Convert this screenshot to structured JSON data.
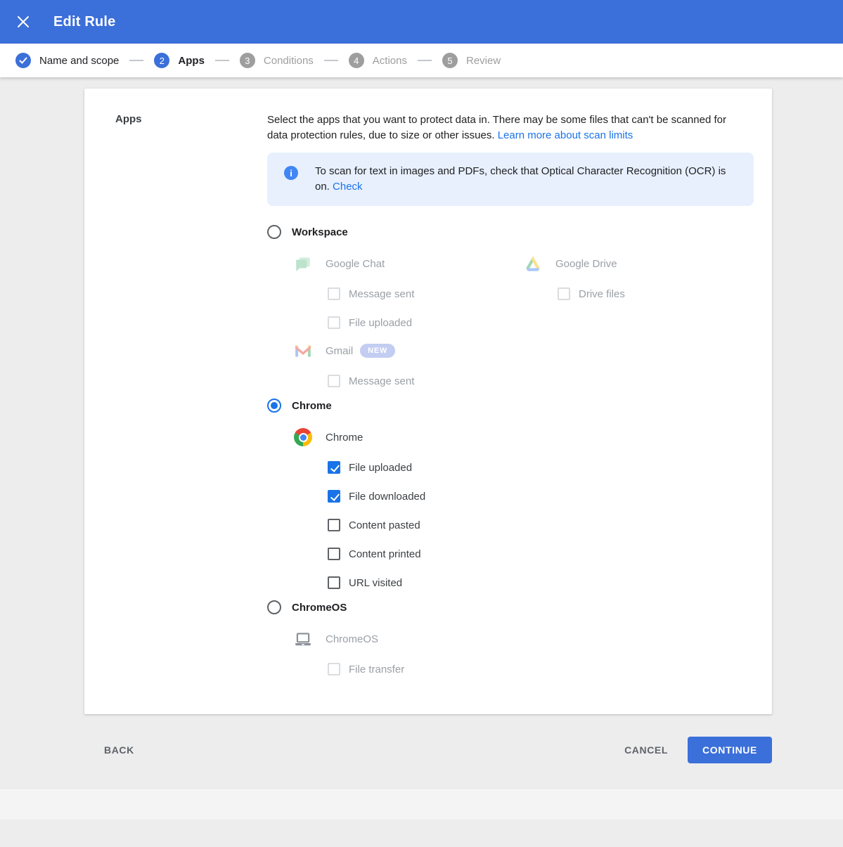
{
  "header": {
    "title": "Edit Rule"
  },
  "stepper": {
    "steps": [
      {
        "label": "Name and scope",
        "state": "complete"
      },
      {
        "number": "2",
        "label": "Apps",
        "state": "active"
      },
      {
        "number": "3",
        "label": "Conditions",
        "state": "upcoming"
      },
      {
        "number": "4",
        "label": "Actions",
        "state": "upcoming"
      },
      {
        "number": "5",
        "label": "Review",
        "state": "upcoming"
      }
    ]
  },
  "card": {
    "section_label": "Apps",
    "intro_text": "Select the apps that you want to protect data in. There may be some files that can't be scanned for data protection rules, due to size or other issues. ",
    "intro_link": "Learn more about scan limits",
    "ocr_banner": {
      "icon": "info-icon",
      "icon_glyph": "i",
      "text": "To scan for text in images and PDFs, check that Optical Character Recognition (OCR) is on. ",
      "link_label": "Check"
    },
    "workspace": {
      "label": "Workspace",
      "selected": false,
      "chat": {
        "name": "Google Chat",
        "icon": "google-chat-icon",
        "events": [
          {
            "label": "Message sent",
            "checked": false
          },
          {
            "label": "File uploaded",
            "checked": false
          }
        ]
      },
      "drive": {
        "name": "Google Drive",
        "icon": "google-drive-icon",
        "events": [
          {
            "label": "Drive files",
            "checked": false
          }
        ]
      },
      "gmail": {
        "name": "Gmail",
        "icon": "gmail-icon",
        "badge": "NEW",
        "events": [
          {
            "label": "Message sent",
            "checked": false
          }
        ]
      }
    },
    "chrome": {
      "label": "Chrome",
      "selected": true,
      "app": {
        "name": "Chrome",
        "icon": "chrome-icon",
        "events": [
          {
            "label": "File uploaded",
            "checked": true
          },
          {
            "label": "File downloaded",
            "checked": true
          },
          {
            "label": "Content pasted",
            "checked": false
          },
          {
            "label": "Content printed",
            "checked": false
          },
          {
            "label": "URL visited",
            "checked": false
          }
        ]
      }
    },
    "chromeos": {
      "label": "ChromeOS",
      "selected": false,
      "app": {
        "name": "ChromeOS",
        "icon": "laptop-icon",
        "events": [
          {
            "label": "File transfer",
            "checked": false
          }
        ]
      }
    }
  },
  "footer": {
    "back_label": "BACK",
    "cancel_label": "CANCEL",
    "continue_label": "CONTINUE"
  },
  "colors": {
    "primary_blue": "#3b6fd9",
    "accent_blue": "#1a73e8",
    "banner_bg": "#e8f0fe",
    "banner_icon_blue": "#4285f4",
    "page_bg": "#ededee"
  }
}
